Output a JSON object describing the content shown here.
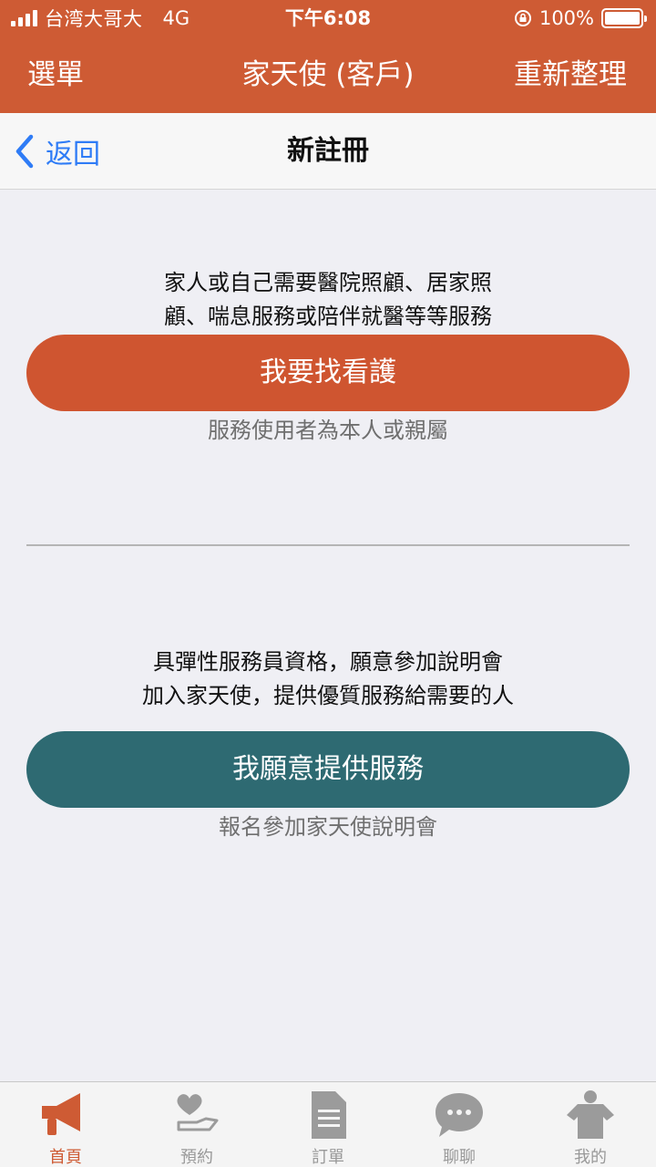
{
  "status_bar": {
    "carrier": "台湾大哥大",
    "network": "4G",
    "time": "下午6:08",
    "battery": "100%",
    "battery_level": 1.0
  },
  "header": {
    "menu_label": "選單",
    "title": "家天使 (客戶)",
    "refresh_label": "重新整理"
  },
  "sub_nav": {
    "back_label": "返回",
    "title": "新註冊"
  },
  "section_care": {
    "line1": "家人或自己需要醫院照顧、居家照",
    "line2": "顧、喘息服務或陪伴就醫等等服務",
    "button_label": "我要找看護",
    "caption": "服務使用者為本人或親屬"
  },
  "section_serve": {
    "line1": "具彈性服務員資格，願意參加說明會",
    "line2": "加入家天使，提供優質服務給需要的人",
    "button_label": "我願意提供服務",
    "caption": "報名參加家天使說明會"
  },
  "tab_bar": {
    "active_color": "#CE5B34",
    "inactive_color": "#9B9B9B",
    "items": [
      {
        "label": "首頁",
        "icon": "megaphone-icon",
        "active": true
      },
      {
        "label": "預約",
        "icon": "heart-hand-icon",
        "active": false
      },
      {
        "label": "訂單",
        "icon": "document-icon",
        "active": false
      },
      {
        "label": "聊聊",
        "icon": "chat-bubble-icon",
        "active": false
      },
      {
        "label": "我的",
        "icon": "person-icon",
        "active": false
      }
    ]
  },
  "colors": {
    "brand_orange": "#CE5B34",
    "button_teal": "#2E6A72",
    "link_blue": "#2F7CF6"
  }
}
